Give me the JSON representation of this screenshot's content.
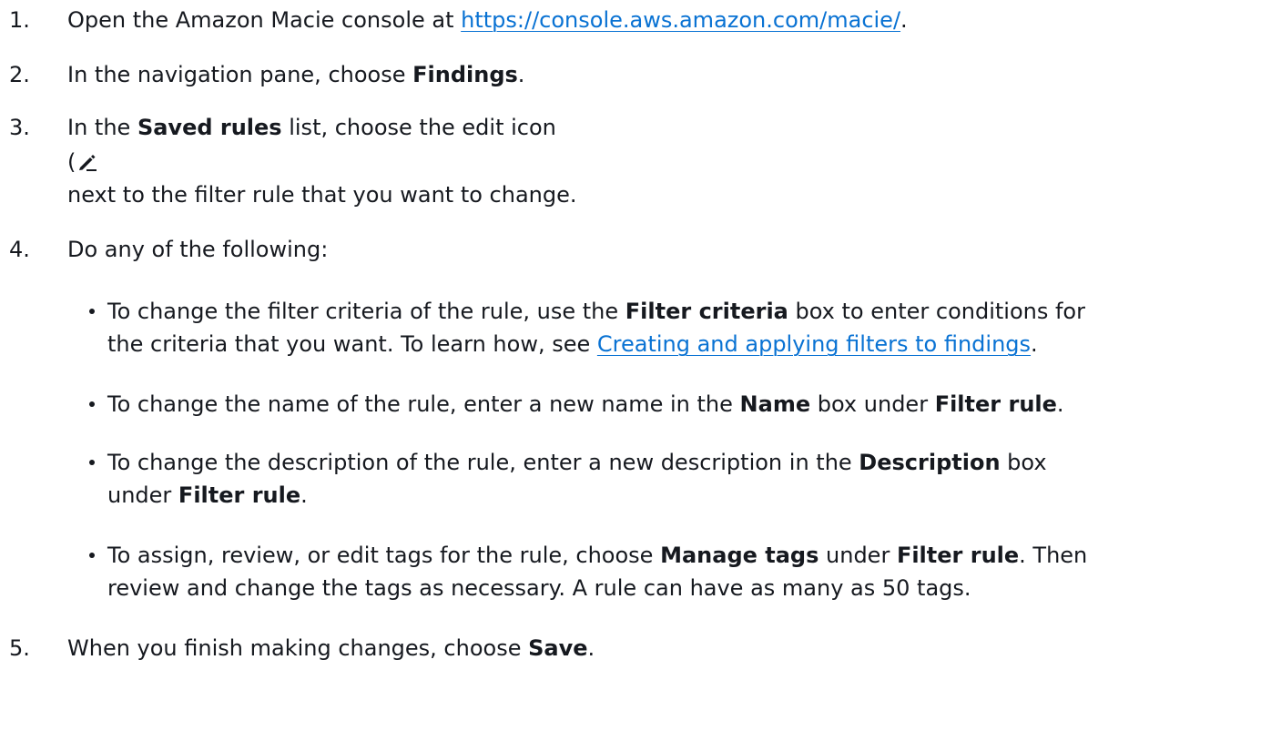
{
  "steps": [
    {
      "number": "1.",
      "before": "Open the Amazon Macie console at ",
      "link": "https://console.aws.amazon.com/macie/",
      "after": "."
    },
    {
      "number": "2.",
      "before": "In the navigation pane, choose ",
      "bold": "Findings",
      "after": "."
    },
    {
      "number": "3.",
      "before": "In the ",
      "bold": "Saved rules",
      "after": " list, choose the edit icon",
      "paren": "(",
      "icon": "pencil-edit-icon",
      "line2": "next to the filter rule that you want to change."
    },
    {
      "number": "4.",
      "text": "Do any of the following:"
    },
    {
      "number": "5.",
      "before": "When you finish making changes, choose ",
      "bold": "Save",
      "after": "."
    }
  ],
  "bullets": [
    {
      "p1": "To change the filter criteria of the rule, use the ",
      "b1": "Filter criteria",
      "p2": " box to enter conditions for",
      "line2_before": "the criteria that you want. To learn how, see ",
      "link": "Creating and applying filters to findings",
      "line2_after": "."
    },
    {
      "p1": "To change the name of the rule, enter a new name in the ",
      "b1": "Name",
      "p2": " box under ",
      "b2": "Filter rule",
      "p3": "."
    },
    {
      "p1": "To change the description of the rule, enter a new description in the ",
      "b1": "Description",
      "p2": " box",
      "line2_before": "under ",
      "b2": "Filter rule",
      "line2_after": "."
    },
    {
      "p1": "To assign, review, or edit tags for the rule, choose ",
      "b1": "Manage tags",
      "p2": " under ",
      "b2": "Filter rule",
      "p3": ". Then",
      "line2": "review and change the tags as necessary. A rule can have as many as 50 tags."
    }
  ]
}
